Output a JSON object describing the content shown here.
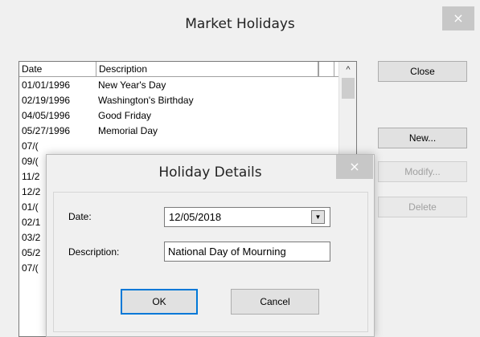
{
  "main_window": {
    "title": "Market Holidays",
    "close_glyph": "×"
  },
  "list": {
    "columns": [
      "Date",
      "Description"
    ],
    "scroll_up_glyph": "^",
    "rows": [
      {
        "date": "01/01/1996",
        "description": "New Year's Day"
      },
      {
        "date": "02/19/1996",
        "description": "Washington's Birthday"
      },
      {
        "date": "04/05/1996",
        "description": "Good Friday"
      },
      {
        "date": "05/27/1996",
        "description": "Memorial Day"
      },
      {
        "date": "07/(",
        "description": ""
      },
      {
        "date": "09/(",
        "description": ""
      },
      {
        "date": "11/2",
        "description": ""
      },
      {
        "date": "12/2",
        "description": ""
      },
      {
        "date": "01/(",
        "description": ""
      },
      {
        "date": "02/1",
        "description": ""
      },
      {
        "date": "03/2",
        "description": ""
      },
      {
        "date": "05/2",
        "description": ""
      },
      {
        "date": "07/(",
        "description": ""
      }
    ]
  },
  "buttons": {
    "close": "Close",
    "new": "New...",
    "modify": "Modify...",
    "delete": "Delete"
  },
  "dialog": {
    "title": "Holiday Details",
    "close_glyph": "×",
    "date_label": "Date:",
    "date_value": "12/05/2018",
    "dropdown_glyph": "▼",
    "description_label": "Description:",
    "description_value": "National Day of Mourning",
    "ok_label": "OK",
    "cancel_label": "Cancel"
  },
  "colors": {
    "window_background": "#f0f0f0",
    "close_box": "#c7c7c7",
    "default_button_border": "#0078d7",
    "disabled_text": "#a0a0a0"
  }
}
